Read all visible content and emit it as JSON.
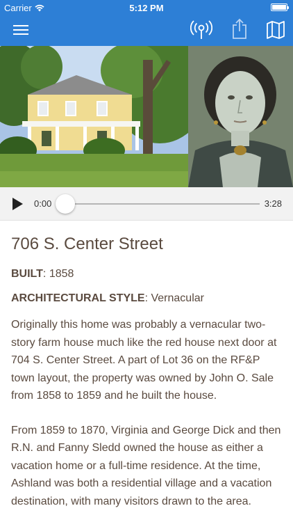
{
  "status_bar": {
    "carrier": "Carrier",
    "time": "5:12 PM",
    "battery_level": 1.0
  },
  "nav": {
    "icons": [
      "menu-icon",
      "radio-broadcast-icon",
      "share-icon",
      "map-icon"
    ]
  },
  "player": {
    "current_time": "0:00",
    "total_time": "3:28",
    "progress": 0
  },
  "article": {
    "title": "706 S. Center Street",
    "built_label": "BUILT",
    "built_value": ": 1858",
    "style_label": "ARCHITECTURAL STYLE",
    "style_value": ": Vernacular",
    "paragraphs": [
      "Originally this home was probably a vernacular two-story farm house much like the red house next door at 704 S. Center Street. A part of Lot 36 on the RF&P town layout, the property was owned by John O. Sale from 1858 to 1859 and he built the house.",
      "From 1859 to 1870, Virginia and George Dick and then R.N. and Fanny Sledd owned the house as either a vacation home or a full-time residence. At the time, Ashland was both a residential village and a vacation destination, with many visitors drawn to the area."
    ]
  },
  "colors": {
    "nav_blue": "#2d7fd6",
    "text_brown": "#5a4a3f",
    "player_bg": "#f2f2f2"
  }
}
